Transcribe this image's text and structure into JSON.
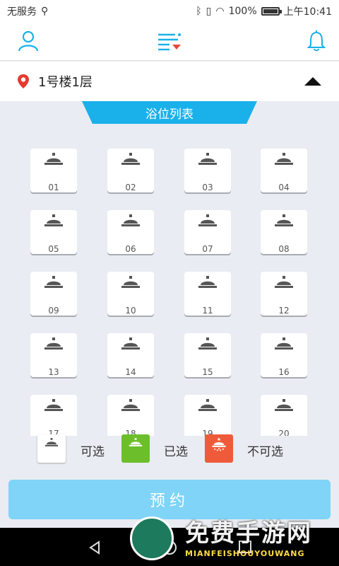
{
  "status_bar": {
    "carrier": "无服务",
    "battery": "100%",
    "time": "上午10:41"
  },
  "app_bar": {
    "icons": [
      "user-icon",
      "filter-menu-icon",
      "bell-icon"
    ],
    "accent_color": "#1ab1ea",
    "menu_marker_color": "#e64a3c"
  },
  "location": {
    "text": "1号楼1层",
    "pin_color": "#e5392f"
  },
  "list_title": "浴位列表",
  "stalls": [
    {
      "num": "01"
    },
    {
      "num": "02"
    },
    {
      "num": "03"
    },
    {
      "num": "04"
    },
    {
      "num": "05"
    },
    {
      "num": "06"
    },
    {
      "num": "07"
    },
    {
      "num": "08"
    },
    {
      "num": "09"
    },
    {
      "num": "10"
    },
    {
      "num": "11"
    },
    {
      "num": "12"
    },
    {
      "num": "13"
    },
    {
      "num": "14"
    },
    {
      "num": "15"
    },
    {
      "num": "16"
    },
    {
      "num": "17"
    },
    {
      "num": "18"
    },
    {
      "num": "19"
    },
    {
      "num": "20"
    }
  ],
  "legend": {
    "available": {
      "label": "可选",
      "color": "#ffffff"
    },
    "selected": {
      "label": "已选",
      "color": "#6cbf2a"
    },
    "unavailable": {
      "label": "不可选",
      "color": "#ef5b3a"
    }
  },
  "reserve_button": "预约",
  "watermark": {
    "title": "免费手游网",
    "subtitle": "MIANFEISHOUYOUWANG"
  }
}
